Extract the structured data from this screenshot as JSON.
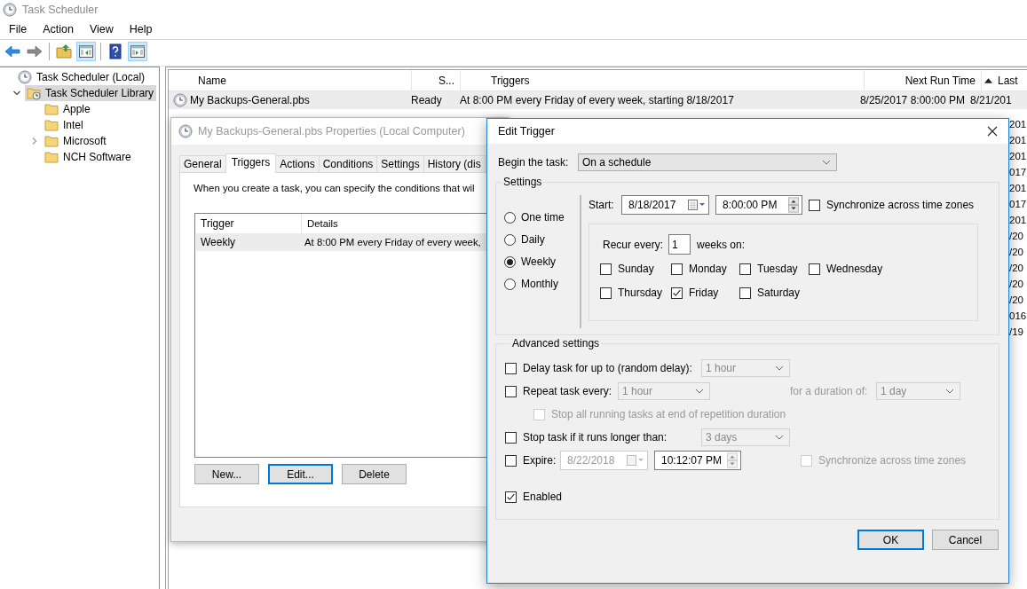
{
  "window": {
    "title": "Task Scheduler"
  },
  "menu": [
    "File",
    "Action",
    "View",
    "Help"
  ],
  "toolbar": [
    [
      {
        "kind": "back",
        "pressed": false
      },
      {
        "kind": "forward",
        "pressed": false
      }
    ],
    [
      {
        "kind": "folder-up",
        "pressed": false
      },
      {
        "kind": "panel-left",
        "pressed": true
      }
    ],
    [
      {
        "kind": "help",
        "pressed": false
      },
      {
        "kind": "panel-right",
        "pressed": true
      }
    ]
  ],
  "tree": [
    {
      "label": "Task Scheduler (Local)",
      "kind": "computer",
      "selected": false,
      "children": [
        {
          "label": "Task Scheduler Library",
          "kind": "library",
          "expanded": true,
          "selected": true,
          "children": [
            {
              "label": "Apple",
              "kind": "folder",
              "selected": false
            },
            {
              "label": "Intel",
              "kind": "folder",
              "selected": false
            },
            {
              "label": "Microsoft",
              "kind": "folder",
              "expanded": false,
              "selected": false
            },
            {
              "label": "NCH Software",
              "kind": "folder",
              "selected": false
            }
          ]
        }
      ]
    }
  ],
  "task_table": {
    "columns": [
      {
        "label": "Name",
        "sorted": false
      },
      {
        "label": "S...",
        "sorted": false
      },
      {
        "label": "Triggers",
        "sorted": false
      },
      {
        "label": "Next Run Time",
        "sorted": false
      },
      {
        "label": "Last",
        "sorted": true
      }
    ],
    "rows": [
      {
        "name": "My Backups-General.pbs",
        "status": "Ready",
        "triggers": "At 8:00 PM every Friday of every week, starting 8/18/2017",
        "next_run": "8/25/2017 8:00:00 PM",
        "last_run": "8/21/201",
        "selected": true
      }
    ],
    "last_run_fragments": [
      "201",
      "201",
      "201",
      "017",
      "201",
      "017",
      "201",
      "/20",
      "/20",
      "/20",
      "/20",
      "/20",
      "016",
      "/19"
    ]
  },
  "properties": {
    "title": "My Backups-General.pbs Properties (Local Computer)",
    "tabs": [
      {
        "label": "General",
        "selected": false
      },
      {
        "label": "Triggers",
        "selected": true
      },
      {
        "label": "Actions",
        "selected": false
      },
      {
        "label": "Conditions",
        "selected": false
      },
      {
        "label": "Settings",
        "selected": false
      },
      {
        "label": "History (dis",
        "selected": false
      }
    ],
    "description": "When you create a task, you can specify the conditions that wil",
    "columns": [
      "Trigger",
      "Details"
    ],
    "rows": [
      {
        "trigger": "Weekly",
        "details": "At 8:00 PM every Friday of every week,",
        "selected": true
      }
    ],
    "buttons": [
      {
        "label": "New...",
        "focused": false
      },
      {
        "label": "Edit...",
        "focused": true
      },
      {
        "label": "Delete",
        "focused": false
      }
    ]
  },
  "edit_trigger": {
    "title": "Edit Trigger",
    "begin_label": "Begin the task:",
    "begin_value": "On a schedule",
    "settings": {
      "title": "Settings",
      "schedules": [
        {
          "label": "One time",
          "selected": false
        },
        {
          "label": "Daily",
          "selected": false
        },
        {
          "label": "Weekly",
          "selected": true
        },
        {
          "label": "Monthly",
          "selected": false
        }
      ],
      "start_label": "Start:",
      "start_date": "8/18/2017",
      "start_time": "8:00:00 PM",
      "sync": {
        "label": "Synchronize across time zones",
        "checked": false
      },
      "recur_label": "Recur every:",
      "recur_value": "1",
      "recur_suffix": "weeks on:",
      "days": [
        {
          "label": "Sunday",
          "checked": false
        },
        {
          "label": "Monday",
          "checked": false
        },
        {
          "label": "Tuesday",
          "checked": false
        },
        {
          "label": "Wednesday",
          "checked": false
        },
        {
          "label": "Thursday",
          "checked": false
        },
        {
          "label": "Friday",
          "checked": true
        },
        {
          "label": "Saturday",
          "checked": false
        }
      ]
    },
    "advanced": {
      "title": "Advanced settings",
      "delay": {
        "label": "Delay task for up to (random delay):",
        "checked": false,
        "value": "1 hour"
      },
      "repeat": {
        "label": "Repeat task every:",
        "checked": false,
        "value": "1 hour",
        "duration_label": "for a duration of:",
        "duration_value": "1 day"
      },
      "stop_all": {
        "label": "Stop all running tasks at end of repetition duration",
        "checked": false
      },
      "stop_long": {
        "label": "Stop task if it runs longer than:",
        "checked": false,
        "value": "3 days"
      },
      "expire": {
        "label": "Expire:",
        "checked": false,
        "date": "8/22/2018",
        "time": "10:12:07 PM",
        "sync_label": "Synchronize across time zones",
        "sync_checked": false
      },
      "enabled": {
        "label": "Enabled",
        "checked": true
      }
    },
    "buttons": [
      {
        "label": "OK",
        "default": true
      },
      {
        "label": "Cancel",
        "default": false
      }
    ]
  }
}
